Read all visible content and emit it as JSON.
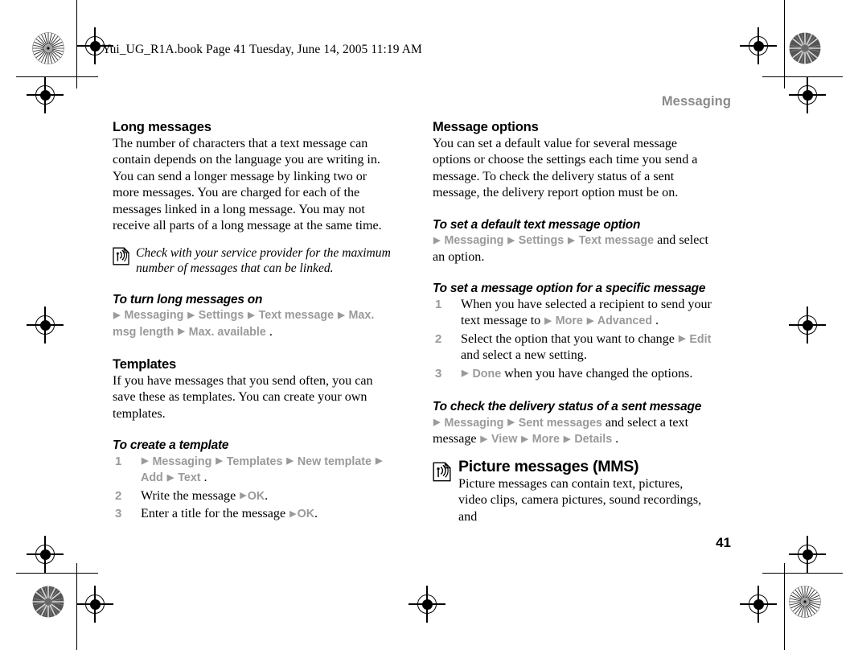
{
  "document": {
    "file_info": "Yui_UG_R1A.book  Page 41  Tuesday, June 14, 2005  11:19 AM",
    "running_head": "Messaging",
    "page_number": "41",
    "nav_color": "#9a9a9a",
    "head_color": "#8a8a8a",
    "text_color": "#000000"
  },
  "left_column": {
    "long_messages": {
      "heading": "Long messages",
      "body": "The number of characters that a text message can contain depends on the language you are writing in. You can send a longer message by linking two or more messages. You are charged for each of the messages linked in a long message. You may not receive all parts of a long message at the same time."
    },
    "note": {
      "icon": "antenna-document-icon",
      "text": "Check with your service provider for the maximum number of messages that can be linked."
    },
    "turn_on": {
      "heading": "To turn long messages on",
      "nav": [
        "Messaging",
        "Settings",
        "Text message",
        "Max. msg length",
        "Max. available"
      ],
      "trailing": "."
    },
    "templates": {
      "heading": "Templates",
      "body": "If you have messages that you send often, you can save these as templates. You can create your own templates."
    },
    "create_template": {
      "heading": "To create a template",
      "steps": [
        {
          "num": "1",
          "nav": [
            "Messaging",
            "Templates",
            "New template",
            "Add",
            "Text"
          ],
          "trailing": "."
        },
        {
          "num": "2",
          "pre": "Write the message ",
          "nav_tail": "OK",
          "trailing": "."
        },
        {
          "num": "3",
          "pre": "Enter a title for the message ",
          "nav_tail": "OK",
          "trailing": "."
        }
      ]
    }
  },
  "right_column": {
    "message_options": {
      "heading": "Message options",
      "body": "You can set a default value for several message options or choose the settings each time you send a message. To check the delivery status of a sent message, the delivery report option must be on."
    },
    "default_text_option": {
      "heading": "To set a default text message option",
      "nav": [
        "Messaging",
        "Settings",
        "Text message"
      ],
      "tail": " and select an option."
    },
    "specific_message": {
      "heading": "To set a message option for a specific message",
      "steps": [
        {
          "num": "1",
          "pre": "When you have selected a recipient to send your text message to ",
          "nav": [
            "More",
            "Advanced"
          ],
          "trailing": "."
        },
        {
          "num": "2",
          "pre": "Select the option that you want to change ",
          "nav": [
            "Edit"
          ],
          "post": " and select a new setting."
        },
        {
          "num": "3",
          "pre": "",
          "nav": [
            "Done"
          ],
          "post": " when you have changed the options."
        }
      ]
    },
    "delivery_status": {
      "heading": "To check the delivery status of a sent message",
      "nav_a": [
        "Messaging",
        "Sent messages"
      ],
      "mid": " and select a text message  ",
      "nav_b": [
        "View",
        "More",
        "Details"
      ],
      "trailing": "."
    },
    "mms": {
      "icon": "antenna-document-icon",
      "heading": "Picture messages (MMS)",
      "body": "Picture messages can contain text, pictures, video clips, camera pictures, sound recordings, and"
    }
  }
}
